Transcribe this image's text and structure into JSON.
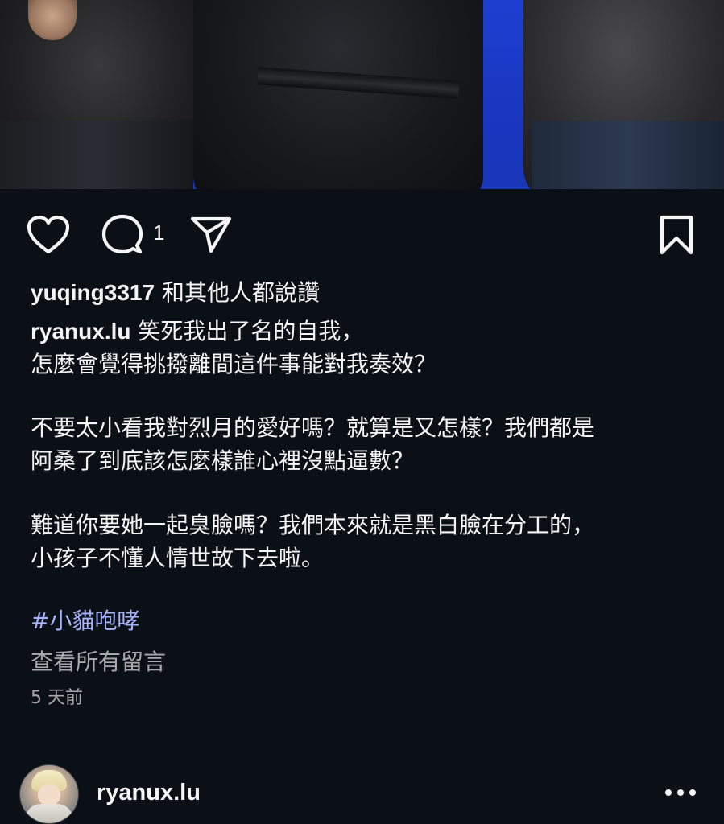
{
  "post": {
    "likes_user": "yuqing3317",
    "likes_suffix": " 和其他人都說讚",
    "comment_count": "1",
    "author": "ryanux.lu",
    "caption_lines": [
      " 笑死我出了名的自我，",
      "怎麼會覺得挑撥離間這件事能對我奏效？",
      "不要太小看我對烈月的愛好嗎？就算是又怎樣？我們都是",
      "阿桑了到底該怎麼樣誰心裡沒點逼數？",
      "難道你要她一起臭臉嗎？我們本來就是黑白臉在分工的，",
      "小孩子不懂人情世故下去啦。"
    ],
    "hashtag": "#小貓咆哮",
    "view_comments": "查看所有留言",
    "time_ago": "5 天前"
  },
  "actions": {
    "like_icon": "heart-outline-icon",
    "comment_icon": "comment-bubble-icon",
    "share_icon": "paper-plane-icon",
    "save_icon": "bookmark-outline-icon"
  },
  "next_post": {
    "username": "ryanux.lu",
    "more_icon": "more-horizontal-icon"
  },
  "colors": {
    "background": "#0b0f16",
    "text": "#f5f5f5",
    "hashtag": "#a7b4ff",
    "muted": "#a8a8ad"
  }
}
